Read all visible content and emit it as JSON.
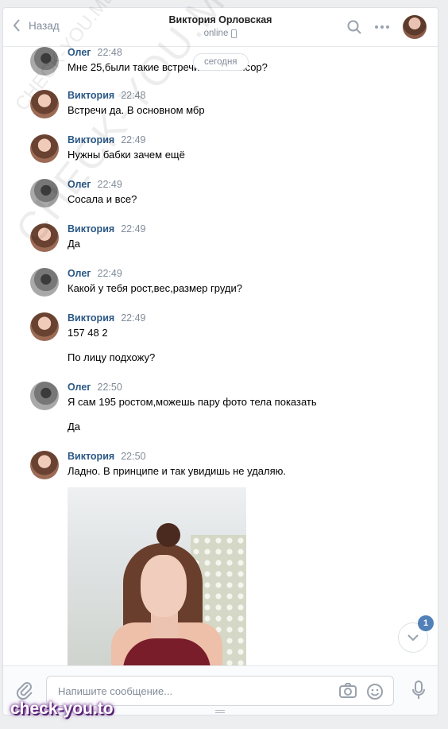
{
  "header": {
    "back_label": "Назад",
    "peer_name": "Виктория Орловская",
    "peer_status": "online"
  },
  "date_separator": "сегодня",
  "messages": [
    {
      "author": "Олег",
      "time": "22:48",
      "lines": [
        "Мне 25,были такие встречи или спонсор?"
      ]
    },
    {
      "author": "Виктория",
      "time": "22:48",
      "lines": [
        "Встречи да. В основном мбр"
      ]
    },
    {
      "author": "Виктория",
      "time": "22:49",
      "lines": [
        "Нужны бабки зачем ещё"
      ]
    },
    {
      "author": "Олег",
      "time": "22:49",
      "lines": [
        "Сосала и все?"
      ]
    },
    {
      "author": "Виктория",
      "time": "22:49",
      "lines": [
        "Да"
      ]
    },
    {
      "author": "Олег",
      "time": "22:49",
      "lines": [
        "Какой у тебя рост,вес,размер груди?"
      ]
    },
    {
      "author": "Виктория",
      "time": "22:49",
      "lines": [
        "157 48 2",
        "По лицу подхожу?"
      ]
    },
    {
      "author": "Олег",
      "time": "22:50",
      "lines": [
        "Я сам 195 ростом,можешь пару фото тела показать",
        "Да"
      ]
    },
    {
      "author": "Виктория",
      "time": "22:50",
      "lines": [
        "Ладно. В принципе и так увидишь не удаляю."
      ]
    }
  ],
  "scroll_badge": "1",
  "composer": {
    "placeholder": "Напишите сообщение..."
  },
  "watermarks": {
    "diagonal": "CHECK-YOU.ME",
    "logo": "check-you.to"
  },
  "colors": {
    "author": "#2a5885",
    "accent": "#5181b8",
    "muted": "#818c99"
  },
  "icons": [
    "chevron-left-icon",
    "phone-icon",
    "search-icon",
    "more-icon",
    "paperclip-icon",
    "camera-icon",
    "emoji-icon",
    "microphone-icon",
    "chevron-down-icon"
  ]
}
